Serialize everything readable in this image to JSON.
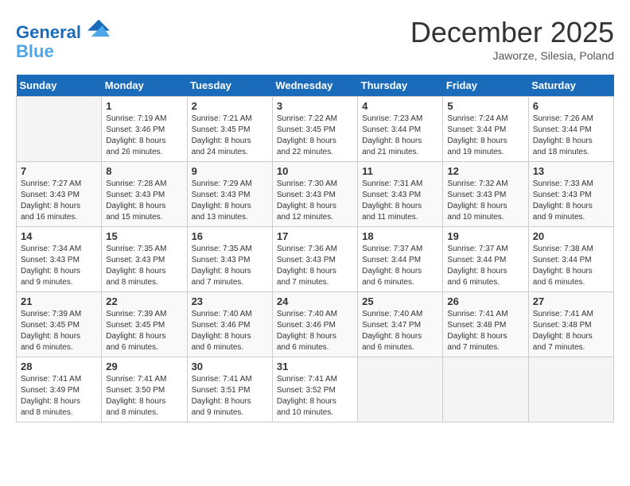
{
  "header": {
    "logo_line1": "General",
    "logo_line2": "Blue",
    "month": "December 2025",
    "location": "Jaworze, Silesia, Poland"
  },
  "days_of_week": [
    "Sunday",
    "Monday",
    "Tuesday",
    "Wednesday",
    "Thursday",
    "Friday",
    "Saturday"
  ],
  "weeks": [
    [
      {
        "num": "",
        "info": ""
      },
      {
        "num": "1",
        "info": "Sunrise: 7:19 AM\nSunset: 3:46 PM\nDaylight: 8 hours\nand 26 minutes."
      },
      {
        "num": "2",
        "info": "Sunrise: 7:21 AM\nSunset: 3:45 PM\nDaylight: 8 hours\nand 24 minutes."
      },
      {
        "num": "3",
        "info": "Sunrise: 7:22 AM\nSunset: 3:45 PM\nDaylight: 8 hours\nand 22 minutes."
      },
      {
        "num": "4",
        "info": "Sunrise: 7:23 AM\nSunset: 3:44 PM\nDaylight: 8 hours\nand 21 minutes."
      },
      {
        "num": "5",
        "info": "Sunrise: 7:24 AM\nSunset: 3:44 PM\nDaylight: 8 hours\nand 19 minutes."
      },
      {
        "num": "6",
        "info": "Sunrise: 7:26 AM\nSunset: 3:44 PM\nDaylight: 8 hours\nand 18 minutes."
      }
    ],
    [
      {
        "num": "7",
        "info": "Sunrise: 7:27 AM\nSunset: 3:43 PM\nDaylight: 8 hours\nand 16 minutes."
      },
      {
        "num": "8",
        "info": "Sunrise: 7:28 AM\nSunset: 3:43 PM\nDaylight: 8 hours\nand 15 minutes."
      },
      {
        "num": "9",
        "info": "Sunrise: 7:29 AM\nSunset: 3:43 PM\nDaylight: 8 hours\nand 13 minutes."
      },
      {
        "num": "10",
        "info": "Sunrise: 7:30 AM\nSunset: 3:43 PM\nDaylight: 8 hours\nand 12 minutes."
      },
      {
        "num": "11",
        "info": "Sunrise: 7:31 AM\nSunset: 3:43 PM\nDaylight: 8 hours\nand 11 minutes."
      },
      {
        "num": "12",
        "info": "Sunrise: 7:32 AM\nSunset: 3:43 PM\nDaylight: 8 hours\nand 10 minutes."
      },
      {
        "num": "13",
        "info": "Sunrise: 7:33 AM\nSunset: 3:43 PM\nDaylight: 8 hours\nand 9 minutes."
      }
    ],
    [
      {
        "num": "14",
        "info": "Sunrise: 7:34 AM\nSunset: 3:43 PM\nDaylight: 8 hours\nand 9 minutes."
      },
      {
        "num": "15",
        "info": "Sunrise: 7:35 AM\nSunset: 3:43 PM\nDaylight: 8 hours\nand 8 minutes."
      },
      {
        "num": "16",
        "info": "Sunrise: 7:35 AM\nSunset: 3:43 PM\nDaylight: 8 hours\nand 7 minutes."
      },
      {
        "num": "17",
        "info": "Sunrise: 7:36 AM\nSunset: 3:43 PM\nDaylight: 8 hours\nand 7 minutes."
      },
      {
        "num": "18",
        "info": "Sunrise: 7:37 AM\nSunset: 3:44 PM\nDaylight: 8 hours\nand 6 minutes."
      },
      {
        "num": "19",
        "info": "Sunrise: 7:37 AM\nSunset: 3:44 PM\nDaylight: 8 hours\nand 6 minutes."
      },
      {
        "num": "20",
        "info": "Sunrise: 7:38 AM\nSunset: 3:44 PM\nDaylight: 8 hours\nand 6 minutes."
      }
    ],
    [
      {
        "num": "21",
        "info": "Sunrise: 7:39 AM\nSunset: 3:45 PM\nDaylight: 8 hours\nand 6 minutes."
      },
      {
        "num": "22",
        "info": "Sunrise: 7:39 AM\nSunset: 3:45 PM\nDaylight: 8 hours\nand 6 minutes."
      },
      {
        "num": "23",
        "info": "Sunrise: 7:40 AM\nSunset: 3:46 PM\nDaylight: 8 hours\nand 6 minutes."
      },
      {
        "num": "24",
        "info": "Sunrise: 7:40 AM\nSunset: 3:46 PM\nDaylight: 8 hours\nand 6 minutes."
      },
      {
        "num": "25",
        "info": "Sunrise: 7:40 AM\nSunset: 3:47 PM\nDaylight: 8 hours\nand 6 minutes."
      },
      {
        "num": "26",
        "info": "Sunrise: 7:41 AM\nSunset: 3:48 PM\nDaylight: 8 hours\nand 7 minutes."
      },
      {
        "num": "27",
        "info": "Sunrise: 7:41 AM\nSunset: 3:48 PM\nDaylight: 8 hours\nand 7 minutes."
      }
    ],
    [
      {
        "num": "28",
        "info": "Sunrise: 7:41 AM\nSunset: 3:49 PM\nDaylight: 8 hours\nand 8 minutes."
      },
      {
        "num": "29",
        "info": "Sunrise: 7:41 AM\nSunset: 3:50 PM\nDaylight: 8 hours\nand 8 minutes."
      },
      {
        "num": "30",
        "info": "Sunrise: 7:41 AM\nSunset: 3:51 PM\nDaylight: 8 hours\nand 9 minutes."
      },
      {
        "num": "31",
        "info": "Sunrise: 7:41 AM\nSunset: 3:52 PM\nDaylight: 8 hours\nand 10 minutes."
      },
      {
        "num": "",
        "info": ""
      },
      {
        "num": "",
        "info": ""
      },
      {
        "num": "",
        "info": ""
      }
    ]
  ]
}
